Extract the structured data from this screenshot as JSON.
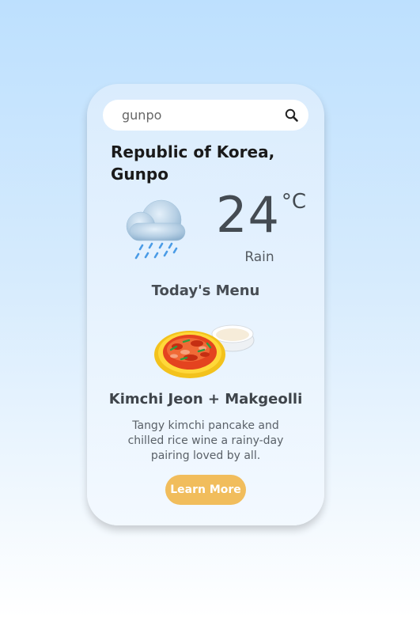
{
  "search": {
    "value": "gunpo",
    "icon": "search-icon"
  },
  "weather": {
    "location": "Republic of Korea, Gunpo",
    "temperature": "24",
    "unit": "°C",
    "condition": "Rain",
    "icon": "rain-cloud-icon"
  },
  "menu": {
    "heading": "Today's Menu",
    "dish_name": "Kimchi Jeon + Makgeolli",
    "description": "Tangy kimchi pancake and chilled rice wine a rainy-day pairing loved by all.",
    "image": "kimchi-pancake-and-makgeolli-illustration",
    "button_label": "Learn More"
  },
  "colors": {
    "background_top": "#bde0fe",
    "card": "#e6f2fe",
    "button": "#f1bd5c",
    "text_dark": "#444b52"
  }
}
